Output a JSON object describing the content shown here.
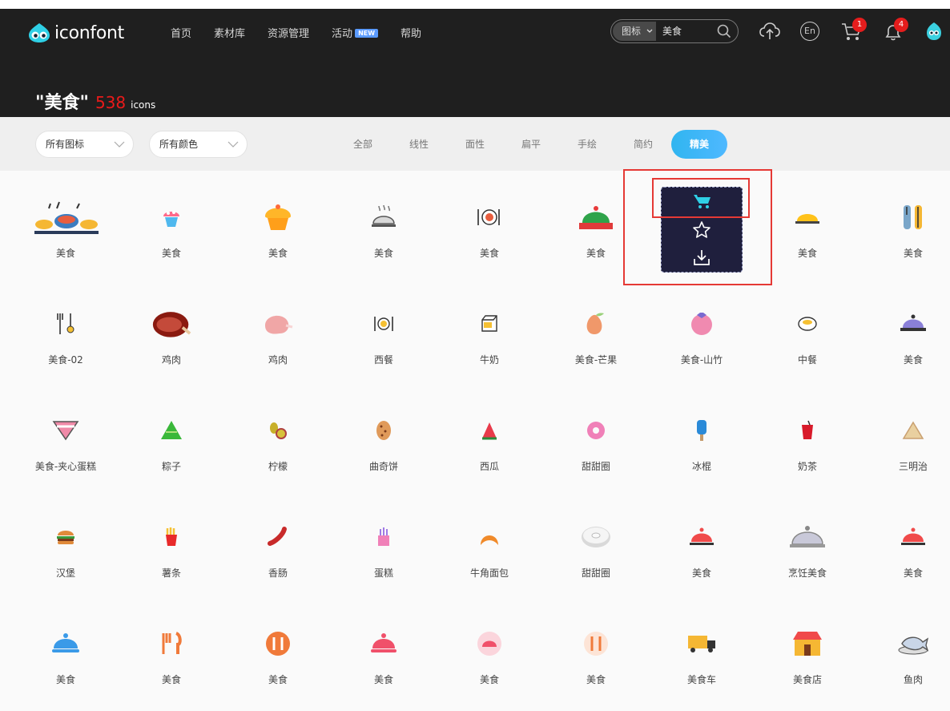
{
  "header": {
    "logo_text": "iconfont",
    "nav": [
      {
        "label": "首页"
      },
      {
        "label": "素材库"
      },
      {
        "label": "资源管理"
      },
      {
        "label": "活动",
        "badge": "NEW"
      },
      {
        "label": "帮助"
      }
    ],
    "search": {
      "type": "图标",
      "value": "美食"
    },
    "cart_count": "1",
    "notification_count": "4",
    "lang": "En",
    "icons": [
      "upload-icon",
      "language-icon",
      "cart-icon",
      "bell-icon",
      "avatar"
    ]
  },
  "title": {
    "query": "\"美食\"",
    "count": "538",
    "unit": "icons"
  },
  "filters": {
    "icon_type": "所有图标",
    "color": "所有颜色",
    "style_tabs": [
      "全部",
      "线性",
      "面性",
      "扁平",
      "手绘",
      "简约",
      "精美"
    ],
    "active_style": "精美"
  },
  "icons": [
    {
      "label": "美食",
      "icon": "food-platter-icon"
    },
    {
      "label": "美食",
      "icon": "cupcake-icon"
    },
    {
      "label": "美食",
      "icon": "muffin-icon"
    },
    {
      "label": "美食",
      "icon": "cloche-icon"
    },
    {
      "label": "美食",
      "icon": "plate-cutlery-icon"
    },
    {
      "label": "美食",
      "icon": "green-cloche-icon"
    },
    {
      "label": "",
      "icon": "hovered-icon"
    },
    {
      "label": "美食",
      "icon": "yellow-cloche-icon"
    },
    {
      "label": "美食",
      "icon": "fork-knife-icon"
    },
    {
      "label": "美食-02",
      "icon": "spoon-fork-icon"
    },
    {
      "label": "鸡肉",
      "icon": "roast-chicken-icon"
    },
    {
      "label": "鸡肉",
      "icon": "chicken-icon"
    },
    {
      "label": "西餐",
      "icon": "western-meal-icon"
    },
    {
      "label": "牛奶",
      "icon": "milk-box-icon"
    },
    {
      "label": "美食-芒果",
      "icon": "mango-icon"
    },
    {
      "label": "美食-山竹",
      "icon": "mangosteen-icon"
    },
    {
      "label": "中餐",
      "icon": "bowl-icon"
    },
    {
      "label": "美食",
      "icon": "purple-cloche-icon"
    },
    {
      "label": "美食-夹心蛋糕",
      "icon": "layer-cake-icon"
    },
    {
      "label": "粽子",
      "icon": "zongzi-icon"
    },
    {
      "label": "柠檬",
      "icon": "lemon-icon"
    },
    {
      "label": "曲奇饼",
      "icon": "cookie-icon"
    },
    {
      "label": "西瓜",
      "icon": "watermelon-icon"
    },
    {
      "label": "甜甜圈",
      "icon": "donut-icon"
    },
    {
      "label": "冰棍",
      "icon": "popsicle-icon"
    },
    {
      "label": "奶茶",
      "icon": "milk-tea-icon"
    },
    {
      "label": "三明治",
      "icon": "sandwich-icon"
    },
    {
      "label": "汉堡",
      "icon": "burger-icon"
    },
    {
      "label": "薯条",
      "icon": "fries-icon"
    },
    {
      "label": "香肠",
      "icon": "sausage-icon"
    },
    {
      "label": "蛋糕",
      "icon": "cake-icon"
    },
    {
      "label": "牛角面包",
      "icon": "croissant-icon"
    },
    {
      "label": "甜甜圈",
      "icon": "glazed-donut-icon"
    },
    {
      "label": "美食",
      "icon": "red-cloche-icon"
    },
    {
      "label": "烹饪美食",
      "icon": "silver-cloche-icon"
    },
    {
      "label": "美食",
      "icon": "red-cloche-icon"
    },
    {
      "label": "美食",
      "icon": "blue-cloche-icon"
    },
    {
      "label": "美食",
      "icon": "orange-cutlery-icon"
    },
    {
      "label": "美食",
      "icon": "round-cutlery-icon"
    },
    {
      "label": "美食",
      "icon": "pink-cloche-icon"
    },
    {
      "label": "美食",
      "icon": "pink-round-cloche-icon"
    },
    {
      "label": "美食",
      "icon": "pale-cutlery-icon"
    },
    {
      "label": "美食车",
      "icon": "food-truck-icon"
    },
    {
      "label": "美食店",
      "icon": "food-shop-icon"
    },
    {
      "label": "鱼肉",
      "icon": "fish-plate-icon"
    }
  ],
  "hover_card": {
    "actions": [
      "cart-icon",
      "star-icon",
      "download-icon"
    ]
  },
  "colors": {
    "header_bg": "#1f1f1f",
    "accent": "#30b5f0",
    "badge": "#e51d1d",
    "highlight_box": "#e53935",
    "card_bg": "#1f1f3d"
  }
}
